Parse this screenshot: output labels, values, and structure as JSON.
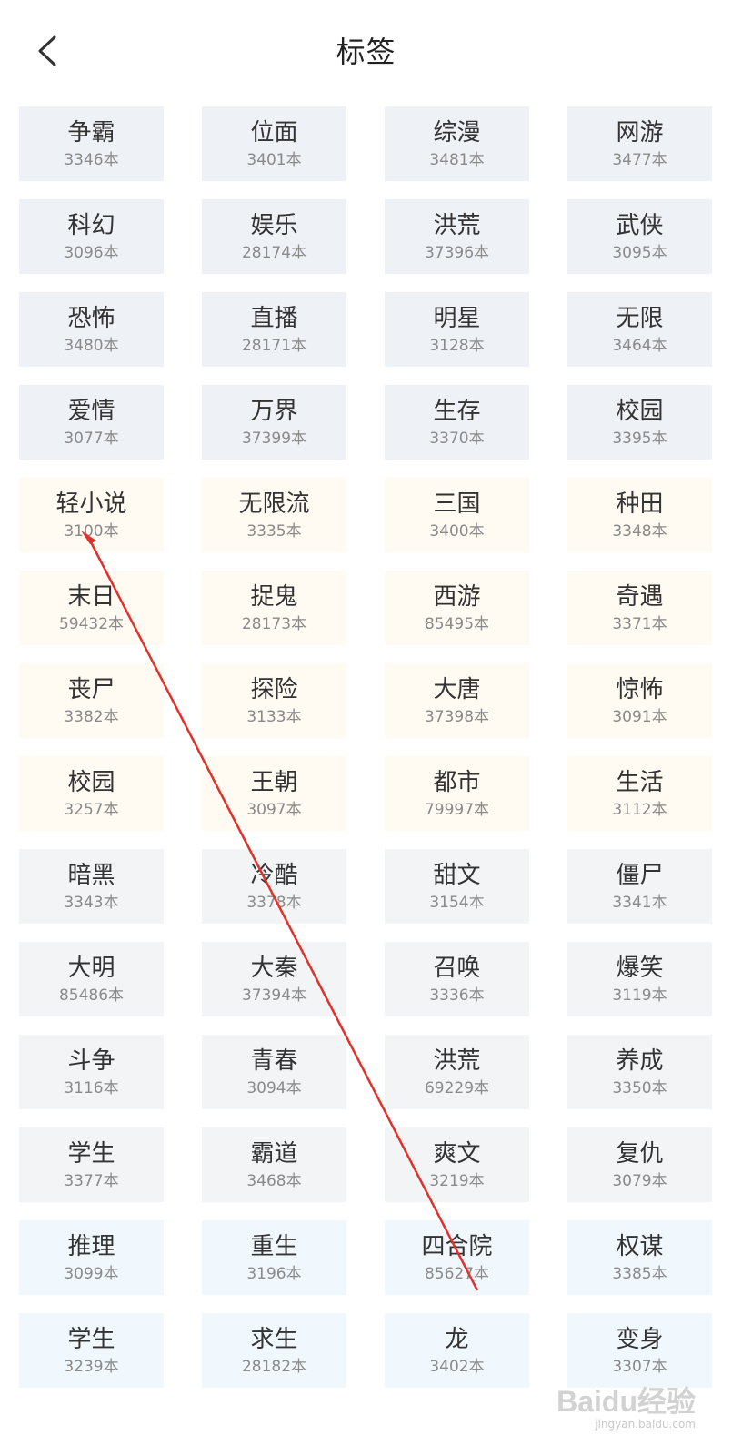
{
  "header": {
    "title": "标签"
  },
  "tags": [
    {
      "row_style": "c-gray",
      "items": [
        {
          "name": "争霸",
          "count": "3346本"
        },
        {
          "name": "位面",
          "count": "3401本"
        },
        {
          "name": "综漫",
          "count": "3481本"
        },
        {
          "name": "网游",
          "count": "3477本"
        }
      ]
    },
    {
      "row_style": "c-gray",
      "items": [
        {
          "name": "科幻",
          "count": "3096本"
        },
        {
          "name": "娱乐",
          "count": "28174本"
        },
        {
          "name": "洪荒",
          "count": "37396本"
        },
        {
          "name": "武侠",
          "count": "3095本"
        }
      ]
    },
    {
      "row_style": "c-gray",
      "items": [
        {
          "name": "恐怖",
          "count": "3480本"
        },
        {
          "name": "直播",
          "count": "28171本"
        },
        {
          "name": "明星",
          "count": "3128本"
        },
        {
          "name": "无限",
          "count": "3464本"
        }
      ]
    },
    {
      "row_style": "c-gray",
      "items": [
        {
          "name": "爱情",
          "count": "3077本"
        },
        {
          "name": "万界",
          "count": "37399本"
        },
        {
          "name": "生存",
          "count": "3370本"
        },
        {
          "name": "校园",
          "count": "3395本"
        }
      ]
    },
    {
      "row_style": "c-cream",
      "items": [
        {
          "name": "轻小说",
          "count": "3100本"
        },
        {
          "name": "无限流",
          "count": "3335本"
        },
        {
          "name": "三国",
          "count": "3400本"
        },
        {
          "name": "种田",
          "count": "3348本"
        }
      ]
    },
    {
      "row_style": "c-cream",
      "items": [
        {
          "name": "末日",
          "count": "59432本"
        },
        {
          "name": "捉鬼",
          "count": "28173本"
        },
        {
          "name": "西游",
          "count": "85495本"
        },
        {
          "name": "奇遇",
          "count": "3371本"
        }
      ]
    },
    {
      "row_style": "c-cream",
      "items": [
        {
          "name": "丧尸",
          "count": "3382本"
        },
        {
          "name": "探险",
          "count": "3133本"
        },
        {
          "name": "大唐",
          "count": "37398本"
        },
        {
          "name": "惊怖",
          "count": "3091本"
        }
      ]
    },
    {
      "row_style": "c-cream",
      "items": [
        {
          "name": "校园",
          "count": "3257本"
        },
        {
          "name": "王朝",
          "count": "3097本"
        },
        {
          "name": "都市",
          "count": "79997本"
        },
        {
          "name": "生活",
          "count": "3112本"
        }
      ]
    },
    {
      "row_style": "c-light",
      "items": [
        {
          "name": "暗黑",
          "count": "3343本"
        },
        {
          "name": "冷酷",
          "count": "3378本"
        },
        {
          "name": "甜文",
          "count": "3154本"
        },
        {
          "name": "僵尸",
          "count": "3341本"
        }
      ]
    },
    {
      "row_style": "c-light",
      "items": [
        {
          "name": "大明",
          "count": "85486本"
        },
        {
          "name": "大秦",
          "count": "37394本"
        },
        {
          "name": "召唤",
          "count": "3336本"
        },
        {
          "name": "爆笑",
          "count": "3119本"
        }
      ]
    },
    {
      "row_style": "c-light",
      "items": [
        {
          "name": "斗争",
          "count": "3116本"
        },
        {
          "name": "青春",
          "count": "3094本"
        },
        {
          "name": "洪荒",
          "count": "69229本"
        },
        {
          "name": "养成",
          "count": "3350本"
        }
      ]
    },
    {
      "row_style": "c-light",
      "items": [
        {
          "name": "学生",
          "count": "3377本"
        },
        {
          "name": "霸道",
          "count": "3468本"
        },
        {
          "name": "爽文",
          "count": "3219本"
        },
        {
          "name": "复仇",
          "count": "3079本"
        }
      ]
    },
    {
      "row_style": "c-blue",
      "items": [
        {
          "name": "推理",
          "count": "3099本"
        },
        {
          "name": "重生",
          "count": "3196本"
        },
        {
          "name": "四合院",
          "count": "85627本"
        },
        {
          "name": "权谋",
          "count": "3385本"
        }
      ]
    },
    {
      "row_style": "c-blue",
      "items": [
        {
          "name": "学生",
          "count": "3239本"
        },
        {
          "name": "求生",
          "count": "28182本"
        },
        {
          "name": "龙",
          "count": "3402本"
        },
        {
          "name": "变身",
          "count": "3307本"
        }
      ]
    }
  ],
  "annotation": {
    "color": "#e0322a"
  },
  "watermark": {
    "logo": "Baidu经验",
    "url": "jingyan.baidu.com"
  }
}
